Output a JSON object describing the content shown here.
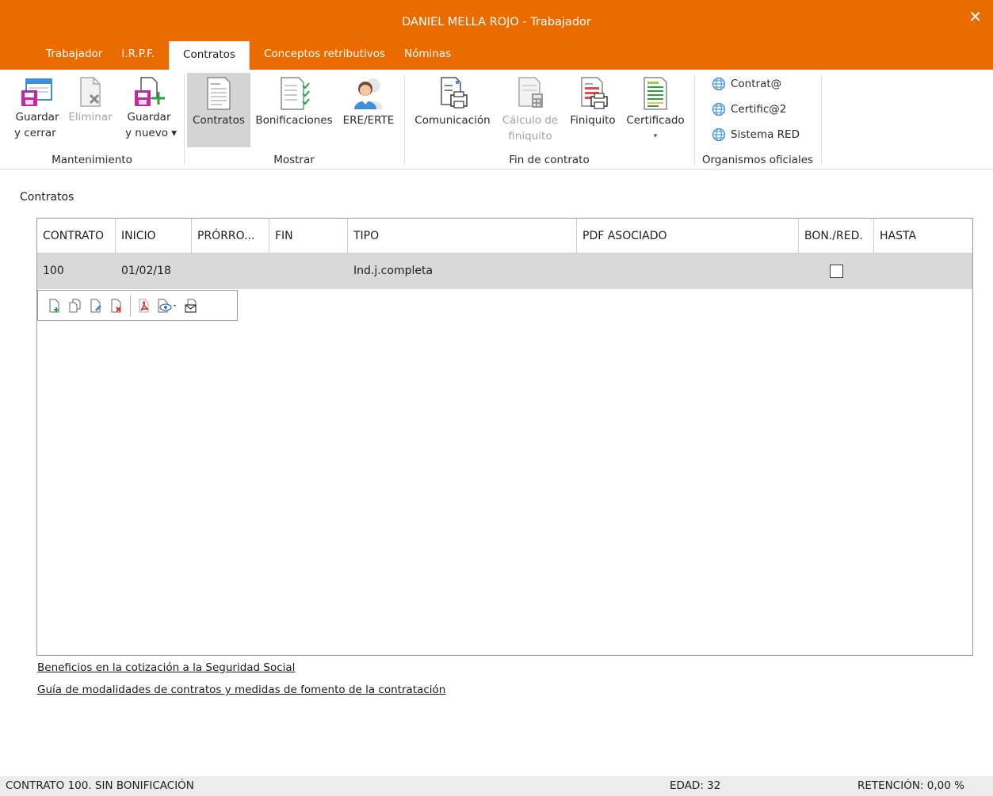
{
  "window": {
    "title": "DANIEL MELLA ROJO - Trabajador",
    "close_glyph": "✕"
  },
  "tabs": [
    {
      "label": "Trabajador",
      "active": false
    },
    {
      "label": "I.R.P.F.",
      "active": false
    },
    {
      "label": "Contratos",
      "active": true
    },
    {
      "label": "Conceptos retributivos",
      "active": false
    },
    {
      "label": "Nóminas",
      "active": false
    }
  ],
  "ribbon": {
    "mantenimiento": {
      "label": "Mantenimiento",
      "guardar_cerrar": {
        "line1": "Guardar",
        "line2": "y cerrar",
        "icon": "save-close-icon"
      },
      "eliminar": {
        "line1": "Eliminar",
        "icon": "delete-document-icon",
        "disabled": true
      },
      "guardar_nuevo": {
        "line1": "Guardar",
        "line2": "y nuevo ▾",
        "icon": "save-new-icon"
      }
    },
    "mostrar": {
      "label": "Mostrar",
      "contratos": {
        "line1": "Contratos",
        "icon": "contracts-document-icon",
        "active": true
      },
      "bonificaciones": {
        "line1": "Bonificaciones",
        "icon": "bonuses-checklist-icon"
      },
      "ere_erte": {
        "line1": "ERE/ERTE",
        "icon": "people-icon"
      }
    },
    "fin_contrato": {
      "label": "Fin de contrato",
      "comunicacion": {
        "line1": "Comunicación",
        "icon": "print-document-icon"
      },
      "calculo": {
        "line1": "Cálculo de",
        "line2": "finiquito",
        "icon": "calculator-document-icon",
        "disabled": true
      },
      "finiquito": {
        "line1": "Finiquito",
        "icon": "settlement-print-icon"
      },
      "certificado": {
        "line1": "Certificado",
        "line2": "▾",
        "icon": "certificate-icon"
      }
    },
    "organismos": {
      "label": "Organismos oficiales",
      "links": [
        {
          "label": "Contrat@",
          "icon": "globe-icon"
        },
        {
          "label": "Certific@2",
          "icon": "globe-icon"
        },
        {
          "label": "Sistema RED",
          "icon": "globe-icon"
        }
      ]
    }
  },
  "section_title": "Contratos",
  "table": {
    "columns": [
      "CONTRATO",
      "INICIO",
      "PRÓRRO...",
      "FIN",
      "TIPO",
      "PDF ASOCIADO",
      "BON./RED.",
      "HASTA"
    ],
    "rows": [
      {
        "contrato": "100",
        "inicio": "01/02/18",
        "prorroga": "",
        "fin": "",
        "tipo": "Ind.j.completa",
        "pdf": "",
        "bon_red": false,
        "hasta": ""
      }
    ]
  },
  "grid_toolbar": [
    {
      "name": "new-icon"
    },
    {
      "name": "duplicate-icon"
    },
    {
      "name": "edit-icon"
    },
    {
      "name": "delete-icon"
    },
    {
      "name": "pdf-icon"
    },
    {
      "name": "view-dropdown-icon"
    },
    {
      "name": "send-mail-icon"
    }
  ],
  "links": {
    "beneficios": "Beneficios en la cotización a la Seguridad Social",
    "guia": "Guía de modalidades de contratos y medidas de fomento de la contratación"
  },
  "status": {
    "left": "CONTRATO 100.  SIN BONIFICACIÓN",
    "edad": "EDAD: 32",
    "retencion": "RETENCIÓN: 0,00 %"
  },
  "colors": {
    "accent": "#ea6b00",
    "row_selected": "#d9d9d9",
    "ribbon_active": "#d4d4d4"
  }
}
